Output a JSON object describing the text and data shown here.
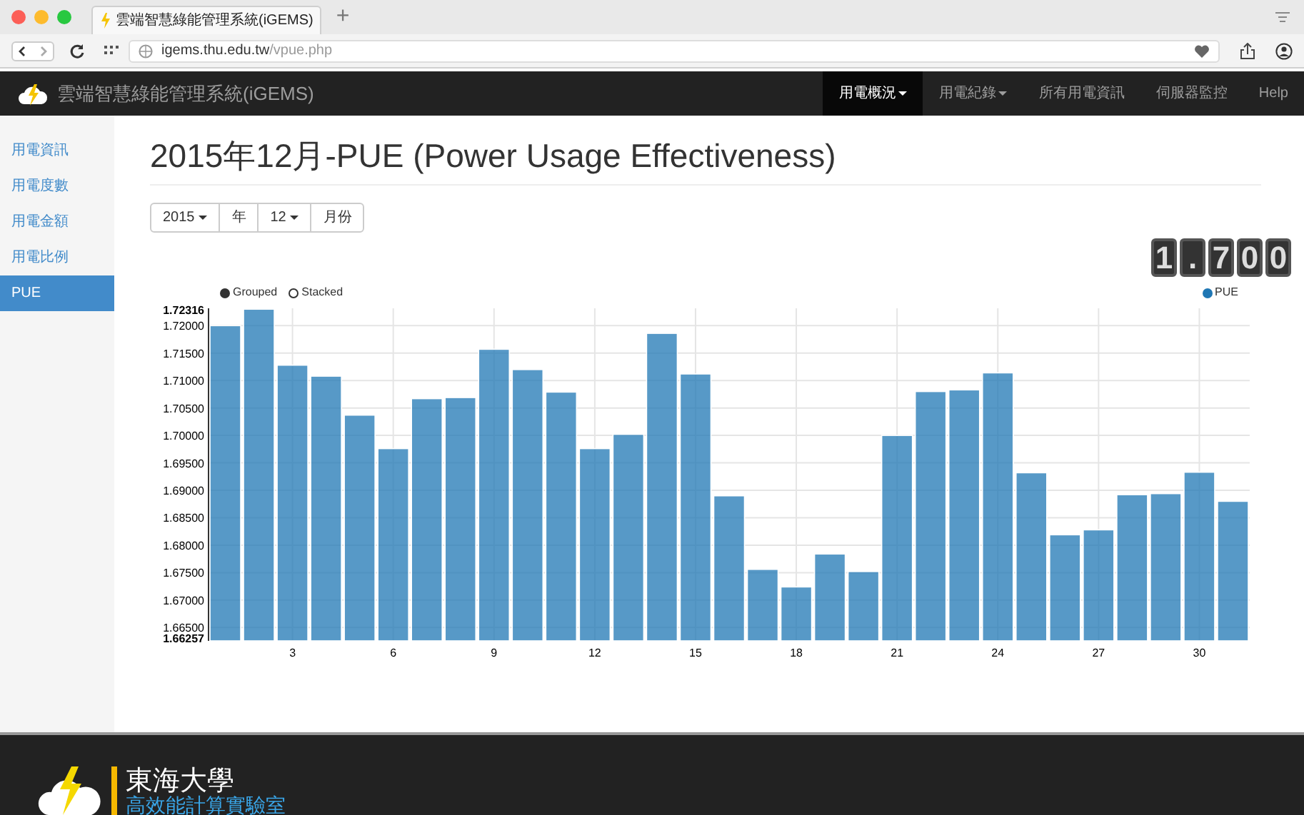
{
  "browser": {
    "tab_title": "雲端智慧綠能管理系統(iGEMS)",
    "url_host": "igems.thu.edu.tw",
    "url_path": "/vpue.php",
    "new_tab": "+"
  },
  "navbar": {
    "brand": "雲端智慧綠能管理系統(iGEMS)",
    "items": [
      {
        "label": "用電概況",
        "dropdown": true,
        "selected": true
      },
      {
        "label": "用電紀錄",
        "dropdown": true,
        "selected": false
      },
      {
        "label": "所有用電資訊",
        "dropdown": false,
        "selected": false
      },
      {
        "label": "伺服器監控",
        "dropdown": false,
        "selected": false
      },
      {
        "label": "Help",
        "dropdown": false,
        "selected": false
      }
    ]
  },
  "sidebar": {
    "items": [
      {
        "label": "用電資訊",
        "selected": false
      },
      {
        "label": "用電度數",
        "selected": false
      },
      {
        "label": "用電金額",
        "selected": false
      },
      {
        "label": "用電比例",
        "selected": false
      },
      {
        "label": "PUE",
        "selected": true
      }
    ]
  },
  "page_title": "2015年12月-PUE (Power Usage Effectiveness)",
  "date_picker": [
    {
      "label": "2015",
      "dropdown": true
    },
    {
      "label": "年",
      "dropdown": false
    },
    {
      "label": "12",
      "dropdown": true
    },
    {
      "label": "月份",
      "dropdown": false
    }
  ],
  "counter_digits": [
    "1",
    ".",
    "7",
    "0",
    "0"
  ],
  "chart_mode": [
    {
      "label": "Grouped",
      "selected": true
    },
    {
      "label": "Stacked",
      "selected": false
    }
  ],
  "chart_data": {
    "type": "bar",
    "grid": true,
    "x": [
      1,
      2,
      3,
      4,
      5,
      6,
      7,
      8,
      9,
      10,
      11,
      12,
      13,
      14,
      15,
      16,
      17,
      18,
      19,
      20,
      21,
      22,
      23,
      24,
      25,
      26,
      27,
      28,
      29,
      30,
      31
    ],
    "series": [
      {
        "name": "PUE",
        "color": "#1f77b4",
        "values": [
          1.72,
          1.723,
          1.7128,
          1.7108,
          1.7037,
          1.6976,
          1.7067,
          1.7069,
          1.7157,
          1.712,
          1.7079,
          1.6976,
          1.7002,
          1.7186,
          1.7112,
          1.689,
          1.6756,
          1.6724,
          1.6784,
          1.6752,
          1.7,
          1.708,
          1.7083,
          1.7114,
          1.6932,
          1.6819,
          1.6828,
          1.6892,
          1.6894,
          1.6933,
          1.688
        ]
      }
    ],
    "xlim": [
      0.5,
      31.5
    ],
    "ylim": [
      1.66257,
      1.72316
    ],
    "yticks": [
      {
        "value": 1.66257,
        "label": "1.66257"
      },
      {
        "value": 1.665,
        "label": "1.66500"
      },
      {
        "value": 1.67,
        "label": "1.67000"
      },
      {
        "value": 1.675,
        "label": "1.67500"
      },
      {
        "value": 1.68,
        "label": "1.68000"
      },
      {
        "value": 1.685,
        "label": "1.68500"
      },
      {
        "value": 1.69,
        "label": "1.69000"
      },
      {
        "value": 1.695,
        "label": "1.69500"
      },
      {
        "value": 1.7,
        "label": "1.70000"
      },
      {
        "value": 1.705,
        "label": "1.70500"
      },
      {
        "value": 1.71,
        "label": "1.71000"
      },
      {
        "value": 1.715,
        "label": "1.71500"
      },
      {
        "value": 1.72,
        "label": "1.72000"
      },
      {
        "value": 1.72316,
        "label": "1.72316"
      }
    ],
    "xticks": [
      3,
      6,
      9,
      12,
      15,
      18,
      21,
      24,
      27,
      30
    ]
  },
  "footer": {
    "university": "東海大學",
    "lab": "高效能計算實驗室"
  }
}
